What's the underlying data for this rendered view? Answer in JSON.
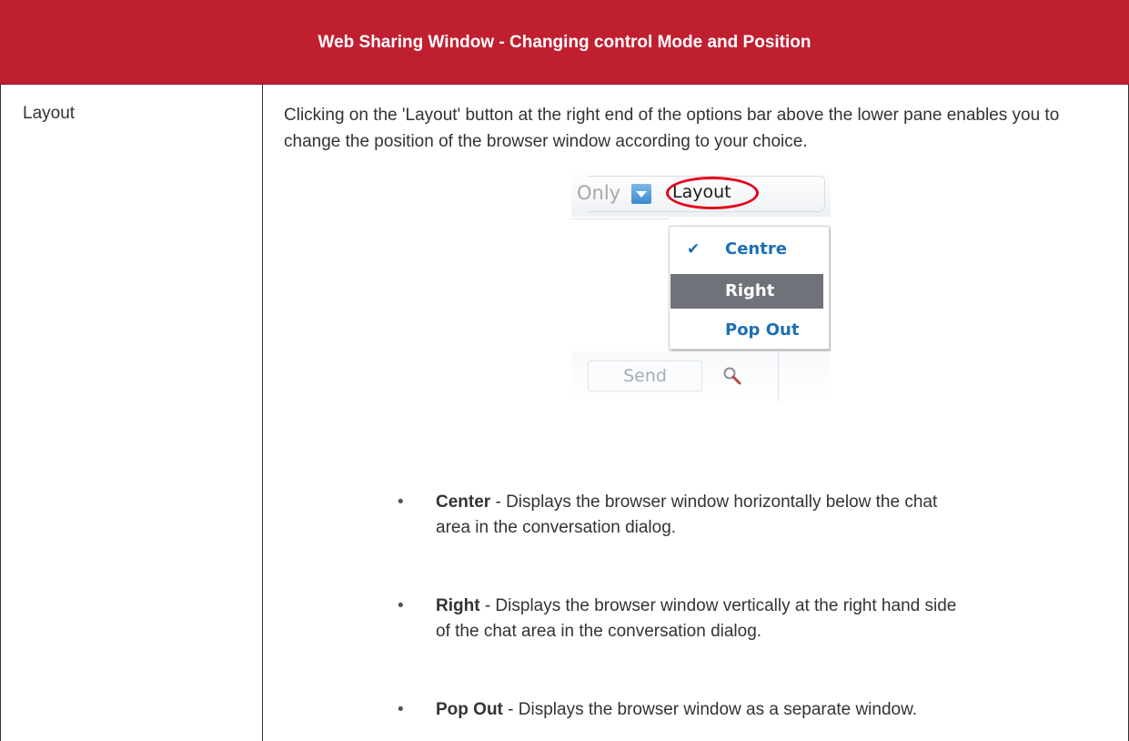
{
  "header": {
    "title": "Web Sharing Window - Changing control Mode and Position",
    "background_color": "#c01f30"
  },
  "row": {
    "label": "Layout",
    "intro": "Clicking on the 'Layout' button at the right end of the options bar above the lower pane enables you to change the position of the browser window according to your choice."
  },
  "screenshot": {
    "only_text": "Only",
    "layout_button": "Layout",
    "menu_items": [
      {
        "label": "Centre",
        "checked": true,
        "highlighted": false
      },
      {
        "label": "Right",
        "checked": false,
        "highlighted": true
      },
      {
        "label": "Pop Out",
        "checked": false,
        "highlighted": false
      }
    ],
    "check_icon": "checkmark-icon",
    "dropdown_icon": "chevron-down-icon",
    "send_button": "Send",
    "search_icon": "magnifier-icon",
    "highlight_oval_color": "#e3001b"
  },
  "bullets": [
    {
      "term": "Center",
      "line1": " - Displays the browser window horizontally below the chat",
      "line2": "area in the conversation dialog."
    },
    {
      "term": "Right",
      "line1": " - Displays the browser window vertically at the right hand side",
      "line2": "of the chat area in the conversation dialog."
    },
    {
      "term": "Pop Out",
      "line1": " - Displays the browser window as a separate window.",
      "line2": ""
    }
  ]
}
